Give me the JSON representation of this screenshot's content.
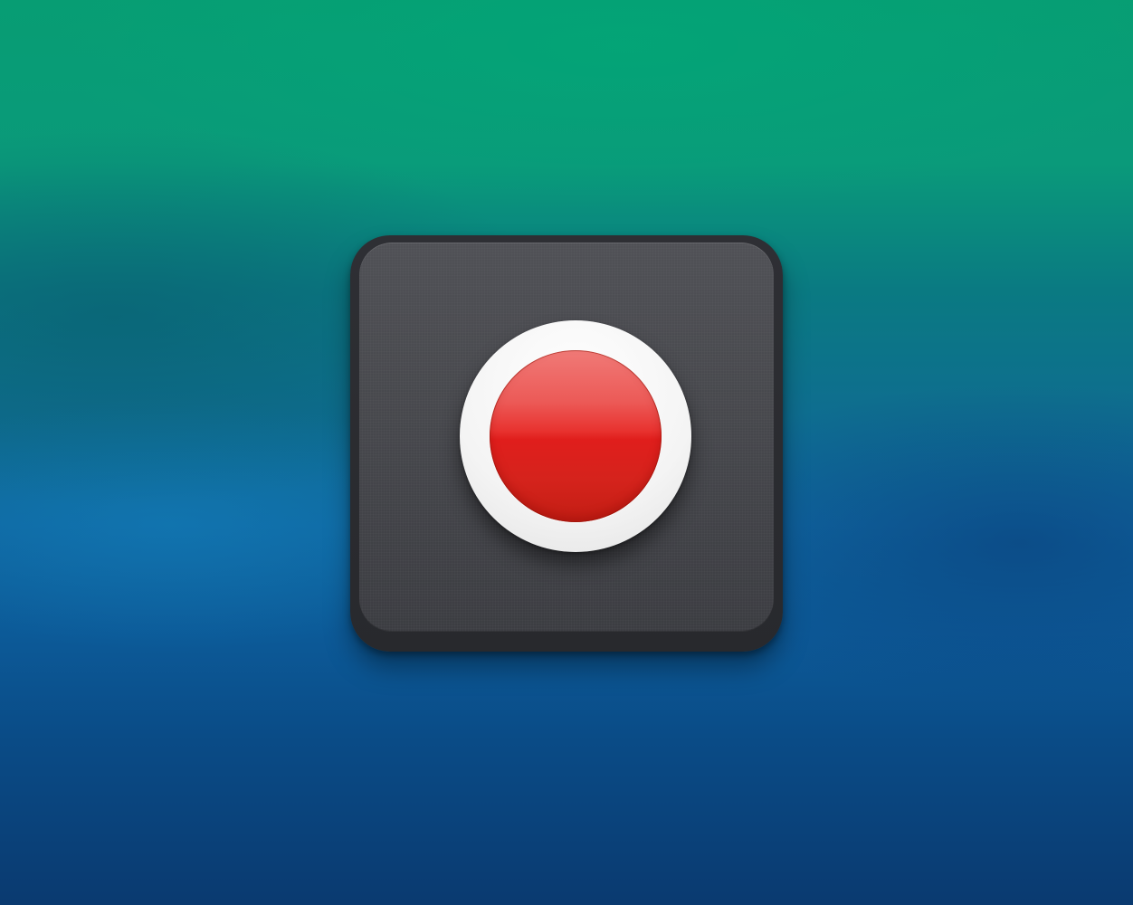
{
  "scene": {
    "background_colors": [
      "#079d73",
      "#0e6e8f",
      "#0f68a2",
      "#0a3a70"
    ],
    "icon": {
      "name": "record-icon",
      "tile_color": "#46474c",
      "ring_color": "#f4f4f4",
      "button_color": "#e01e1c"
    }
  }
}
